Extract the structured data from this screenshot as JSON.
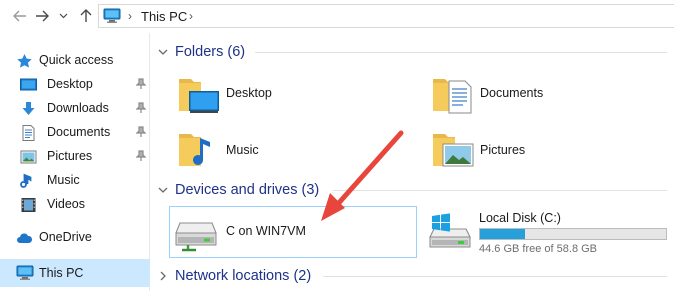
{
  "address_bar": {
    "back_icon": "back-arrow-icon",
    "forward_icon": "forward-arrow-icon",
    "recent_icon": "chevron-down-icon",
    "up_icon": "up-arrow-icon",
    "location_icon": "computer-icon",
    "crumb": "This PC",
    "separator": "›"
  },
  "sidebar": {
    "quick_access": {
      "label": "Quick access",
      "icon": "star-icon"
    },
    "pinned": [
      {
        "label": "Desktop",
        "icon": "desktop-folder-icon",
        "pinned": true
      },
      {
        "label": "Downloads",
        "icon": "download-arrow-icon",
        "pinned": true
      },
      {
        "label": "Documents",
        "icon": "documents-icon",
        "pinned": true
      },
      {
        "label": "Pictures",
        "icon": "pictures-icon",
        "pinned": true
      },
      {
        "label": "Music",
        "icon": "music-note-icon",
        "pinned": false
      },
      {
        "label": "Videos",
        "icon": "videos-icon",
        "pinned": false
      }
    ],
    "onedrive": {
      "label": "OneDrive",
      "icon": "cloud-icon"
    },
    "this_pc": {
      "label": "This PC",
      "icon": "computer-icon",
      "selected": true
    }
  },
  "groups": {
    "folders": {
      "title": "Folders (6)",
      "expanded": true
    },
    "devices": {
      "title": "Devices and drives (3)",
      "expanded": true
    },
    "network": {
      "title": "Network locations (2)",
      "expanded": false
    }
  },
  "folders": [
    {
      "name": "Desktop",
      "icon": "desktop-folder-icon"
    },
    {
      "name": "Documents",
      "icon": "documents-folder-icon"
    },
    {
      "name": "Music",
      "icon": "music-folder-icon"
    },
    {
      "name": "Pictures",
      "icon": "pictures-folder-icon"
    }
  ],
  "drives": [
    {
      "name": "C on WIN7VM",
      "icon": "network-drive-icon",
      "selected": true
    },
    {
      "name": "Local Disk (C:)",
      "icon": "windows-drive-icon",
      "free_text": "44.6 GB free of 58.8 GB",
      "used_fraction": 0.2415
    }
  ],
  "colors": {
    "accent": "#26a0da",
    "group_title": "#1e3287",
    "selection": "#cce8ff",
    "annotation_arrow": "#e8463c"
  }
}
